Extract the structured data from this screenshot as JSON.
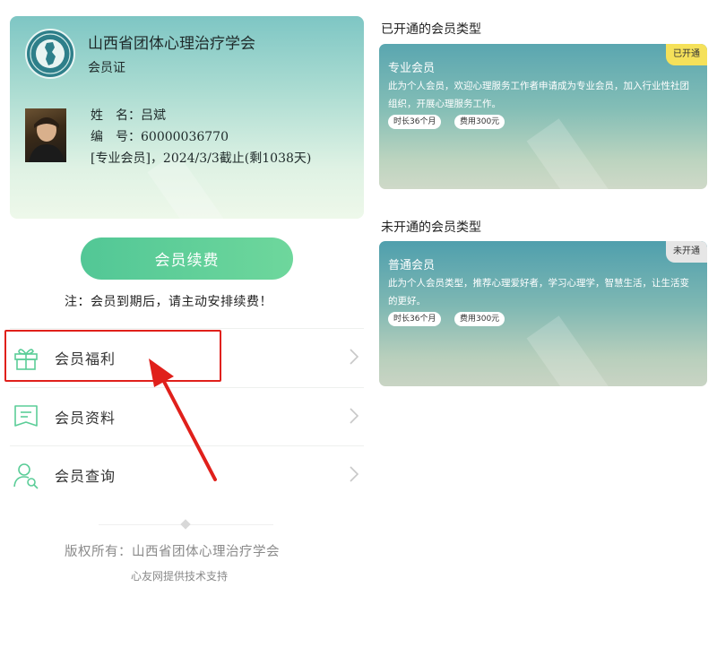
{
  "card": {
    "org_name": "山西省团体心理治疗学会",
    "card_type": "会员证",
    "name_line": "姓　名：吕斌",
    "number_line": "编　号：60000036770",
    "status_line": "[专业会员]，2024/3/3截止(剩1038天)"
  },
  "renew_button": "会员续费",
  "note": "注：会员到期后，请主动安排续费！",
  "menu": [
    {
      "label": "会员福利",
      "icon": "gift-icon"
    },
    {
      "label": "会员资料",
      "icon": "document-icon"
    },
    {
      "label": "会员查询",
      "icon": "user-search-icon"
    }
  ],
  "footer": {
    "copyright": "版权所有：山西省团体心理治疗学会",
    "support": "心友网提供技术支持"
  },
  "activated": {
    "section_title": "已开通的会员类型",
    "name": "专业会员",
    "desc": "此为个人会员，欢迎心理服务工作者申请成为专业会员，加入行业性社团组织，开展心理服务工作。",
    "duration": "时长36个月",
    "fee": "费用300元",
    "status": "已开通",
    "status_color": "#f5e15a"
  },
  "inactive": {
    "section_title": "未开通的会员类型",
    "name": "普通会员",
    "desc": "此为个人会员类型，推荐心理爱好者，学习心理学，智慧生活，让生活变的更好。",
    "duration": "时长36个月",
    "fee": "费用300元",
    "status": "未开通",
    "status_color": "#e6e6e6"
  },
  "colors": {
    "accent_green": "#5bcd98",
    "highlight_red": "#e0201b"
  }
}
